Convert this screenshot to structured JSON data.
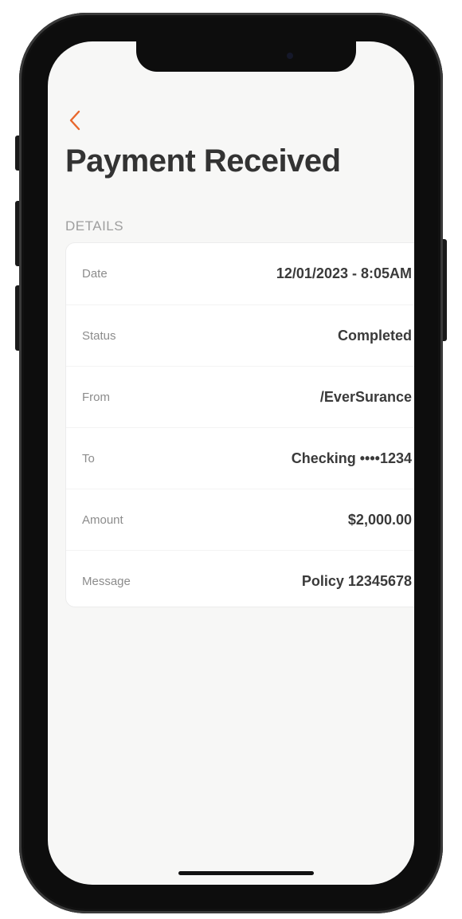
{
  "header": {
    "title": "Payment Received"
  },
  "details": {
    "section_label": "DETAILS",
    "rows": [
      {
        "label": "Date",
        "value": "12/01/2023 - 8:05AM"
      },
      {
        "label": "Status",
        "value": "Completed"
      },
      {
        "label": "From",
        "value": "/EverSurance"
      },
      {
        "label": "To",
        "value": "Checking ••••1234"
      },
      {
        "label": "Amount",
        "value": "$2,000.00"
      },
      {
        "label": "Message",
        "value": "Policy 12345678"
      }
    ]
  },
  "icons": {
    "back": "chevron-left-icon"
  },
  "colors": {
    "accent": "#e8672c",
    "title": "#333333",
    "screen_background": "#f7f7f6",
    "card_background": "#ffffff"
  }
}
